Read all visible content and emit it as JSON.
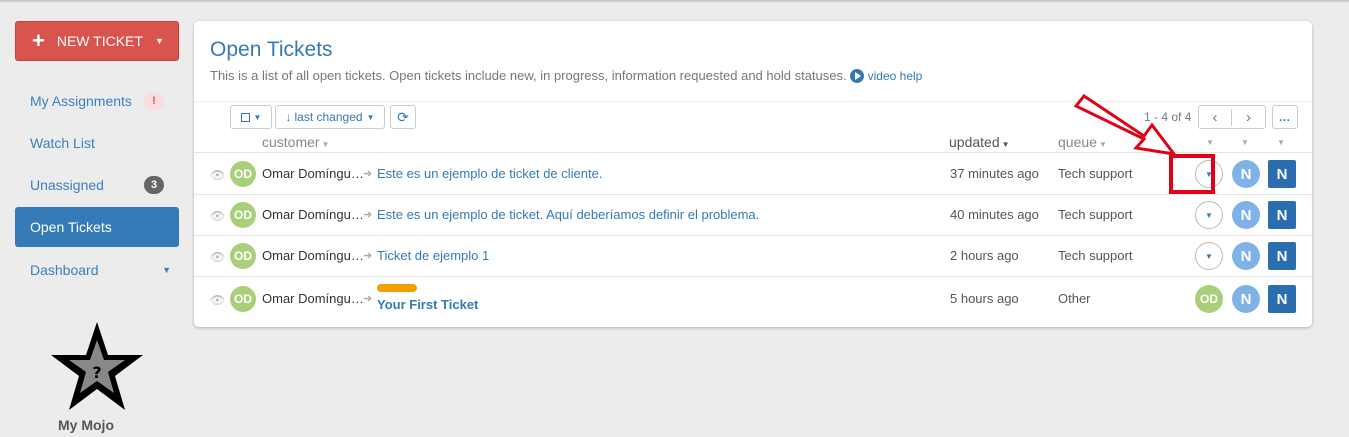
{
  "sidebar": {
    "new_ticket_label": "NEW TICKET",
    "items": [
      {
        "label": "My Assignments",
        "badge": "!"
      },
      {
        "label": "Watch List"
      },
      {
        "label": "Unassigned",
        "badge": "3"
      },
      {
        "label": "Open Tickets",
        "active": true
      },
      {
        "label": "Dashboard"
      }
    ],
    "mojo_label": "My Mojo"
  },
  "main": {
    "title": "Open Tickets",
    "description": "This is a list of all open tickets. Open tickets include new, in progress, information requested and hold statuses.",
    "video_help": "video help",
    "sort_label": "last changed",
    "pager_text": "1 - 4 of 4",
    "columns": {
      "customer": "customer",
      "updated": "updated",
      "queue": "queue"
    },
    "tickets": [
      {
        "avatar": "OD",
        "customer": "Omar Domíngu…",
        "subject": "Este es un ejemplo de ticket de cliente.",
        "updated": "37 minutes ago",
        "queue": "Tech support",
        "assignee": "",
        "agent1": "N",
        "agent2": "N"
      },
      {
        "avatar": "OD",
        "customer": "Omar Domíngu…",
        "subject": "Este es un ejemplo de ticket. Aquí deberíamos definir el problema.",
        "updated": "40 minutes ago",
        "queue": "Tech support",
        "assignee": "",
        "agent1": "N",
        "agent2": "N"
      },
      {
        "avatar": "OD",
        "customer": "Omar Domíngu…",
        "subject": "Ticket de ejemplo 1",
        "updated": "2 hours ago",
        "queue": "Tech support",
        "assignee": "",
        "agent1": "N",
        "agent2": "N"
      },
      {
        "avatar": "OD",
        "customer": "Omar Domíngu…",
        "subject": "Your First Ticket",
        "updated": "5 hours ago",
        "queue": "Other",
        "assignee": "OD",
        "agent1": "N",
        "agent2": "N"
      }
    ]
  },
  "colors": {
    "primary": "#337ab7",
    "danger": "#d9534f",
    "avatar_green": "#a9cf7a",
    "agent_light": "#7fb3e8",
    "agent_dark": "#2a6eb0",
    "annotation_red": "#e0001a",
    "tag_orange": "#f0a000"
  },
  "icons": [
    "plus-icon",
    "caret-down-icon",
    "eye-icon",
    "share-arrow-icon",
    "refresh-icon",
    "chevron-left-icon",
    "chevron-right-icon",
    "more-icon",
    "play-icon",
    "star-icon"
  ]
}
